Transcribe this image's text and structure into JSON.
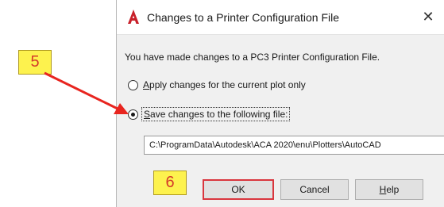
{
  "dialog": {
    "title": "Changes to a Printer Configuration File",
    "close_symbol": "✕",
    "message": "You have made changes to a PC3 Printer Configuration File.",
    "options": [
      {
        "label_first": "A",
        "label_rest": "pply changes for the current plot only",
        "selected": false
      },
      {
        "label_first": "S",
        "label_rest": "ave changes to the following file:",
        "selected": true
      }
    ],
    "file_path": "C:\\ProgramData\\Autodesk\\ACA 2020\\enu\\Plotters\\AutoCAD",
    "buttons": {
      "ok": "OK",
      "cancel": "Cancel",
      "help_first": "H",
      "help_rest": "elp"
    }
  },
  "annotations": {
    "step5": "5",
    "step6": "6",
    "arrow_color": "#e8251f",
    "badge_color": "#fdf24e"
  },
  "icons": {
    "app": "autocad-a-icon",
    "close": "close-icon"
  }
}
